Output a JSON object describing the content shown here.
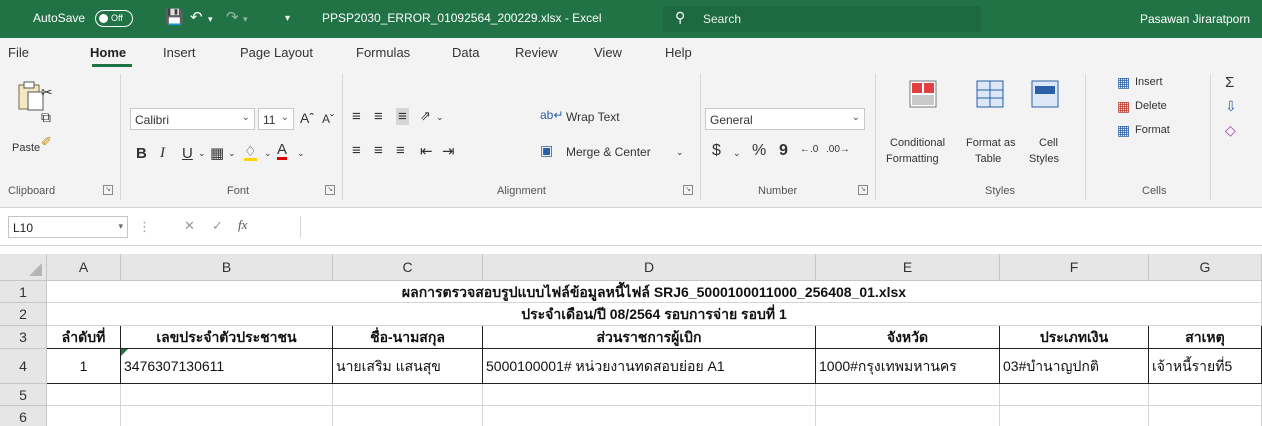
{
  "titlebar": {
    "autosave_label": "AutoSave",
    "autosave_state": "Off",
    "filename": "PPSP2030_ERROR_01092564_200229.xlsx  -  Excel",
    "search_placeholder": "Search",
    "user_name": "Pasawan Jiraratporn",
    "bg_color": "#217346"
  },
  "ribbon_tabs": [
    "File",
    "Home",
    "Insert",
    "Page Layout",
    "Formulas",
    "Data",
    "Review",
    "View",
    "Help"
  ],
  "active_tab": "Home",
  "clipboard": {
    "paste_label": "Paste",
    "group_label": "Clipboard"
  },
  "font": {
    "name": "Calibri",
    "size": "11",
    "group_label": "Font",
    "bold": "B",
    "italic": "I",
    "underline": "U"
  },
  "alignment": {
    "wrap_text": "Wrap Text",
    "merge_center": "Merge & Center",
    "group_label": "Alignment"
  },
  "number": {
    "format": "General",
    "currency": "$",
    "percent": "%",
    "comma": "9",
    "group_label": "Number"
  },
  "styles": {
    "conditional_formatting_line1": "Conditional",
    "conditional_formatting_line2": "Formatting",
    "format_as_table_line1": "Format as",
    "format_as_table_line2": "Table",
    "cell_styles_line1": "Cell",
    "cell_styles_line2": "Styles",
    "group_label": "Styles"
  },
  "cells_group": {
    "insert": "Insert",
    "delete": "Delete",
    "format": "Format",
    "group_label": "Cells"
  },
  "formula_bar": {
    "name_box": "L10",
    "fx": "fx",
    "formula": ""
  },
  "columns": [
    "A",
    "B",
    "C",
    "D",
    "E",
    "F",
    "G"
  ],
  "rows": [
    "1",
    "2",
    "3",
    "4",
    "5",
    "6"
  ],
  "sheet": {
    "title_row1": "ผลการตรวจสอบรูปแบบไฟล์ข้อมูลหนี้ไฟล์ SRJ6_5000100011000_256408_01.xlsx",
    "title_row2": "ประจำเดือน/ปี 08/2564 รอบการจ่าย  รอบที่ 1",
    "headers": [
      "ลำดับที่",
      "เลขประจำตัวประชาชน",
      "ชื่อ-นามสกุล",
      "ส่วนราชการผู้เบิก",
      "จังหวัด",
      "ประเภทเงิน",
      "สาเหตุ"
    ],
    "row4": [
      "1",
      "3476307130611",
      "นายเสริม แสนสุข",
      "5000100001# หน่วยงานทดสอบย่อย A1",
      "1000#กรุงเทพมหานคร",
      "03#บำนาญปกติ",
      "เจ้าหนี้รายที่5"
    ]
  }
}
